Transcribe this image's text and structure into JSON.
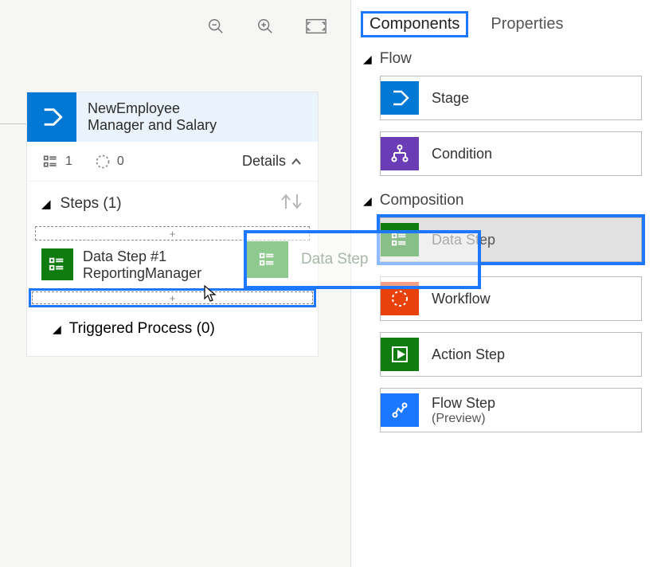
{
  "toolbar": {
    "zoom_out": "−",
    "zoom_in": "+"
  },
  "stage": {
    "title1": "NewEmployee",
    "title2": "Manager and Salary",
    "stat1": "1",
    "stat2": "0",
    "details_label": "Details",
    "steps_label": "Steps (1)",
    "step1_title": "Data Step #1",
    "step1_sub": "ReportingManager",
    "triggered_label": "Triggered Process (0)",
    "drop_plus": "+"
  },
  "drag": {
    "label": "Data Step"
  },
  "tabs": {
    "components": "Components",
    "properties": "Properties"
  },
  "sections": {
    "flow": "Flow",
    "composition": "Composition"
  },
  "components": {
    "stage": "Stage",
    "condition": "Condition",
    "data_step": "Data Step",
    "workflow": "Workflow",
    "action_step": "Action Step",
    "flow_step": "Flow Step",
    "flow_step_sub": "(Preview)"
  }
}
